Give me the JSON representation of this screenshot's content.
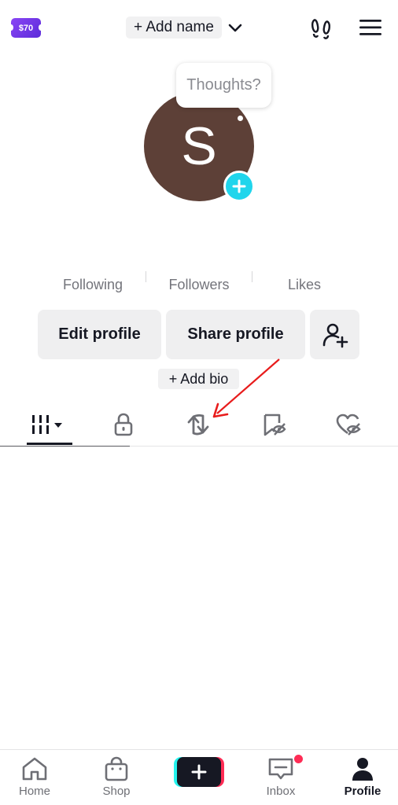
{
  "header": {
    "coupon_label": "$70",
    "add_name_label": "+ Add name"
  },
  "avatar": {
    "initial": "S",
    "bubble_text": "Thoughts?",
    "color": "#5d4037",
    "plus_color": "#20d5ec"
  },
  "stats": {
    "following_label": "Following",
    "followers_label": "Followers",
    "likes_label": "Likes"
  },
  "actions": {
    "edit_profile": "Edit profile",
    "share_profile": "Share profile",
    "add_bio": "+ Add bio"
  },
  "tabs": [
    {
      "icon": "videos-grid-icon",
      "selected": true
    },
    {
      "icon": "lock-icon"
    },
    {
      "icon": "repost-icon"
    },
    {
      "icon": "favorites-icon"
    },
    {
      "icon": "liked-icon"
    }
  ],
  "annotation": {
    "arrow_color": "#e81c1c"
  },
  "bottom_nav": {
    "home": "Home",
    "shop": "Shop",
    "inbox": "Inbox",
    "profile": "Profile"
  }
}
